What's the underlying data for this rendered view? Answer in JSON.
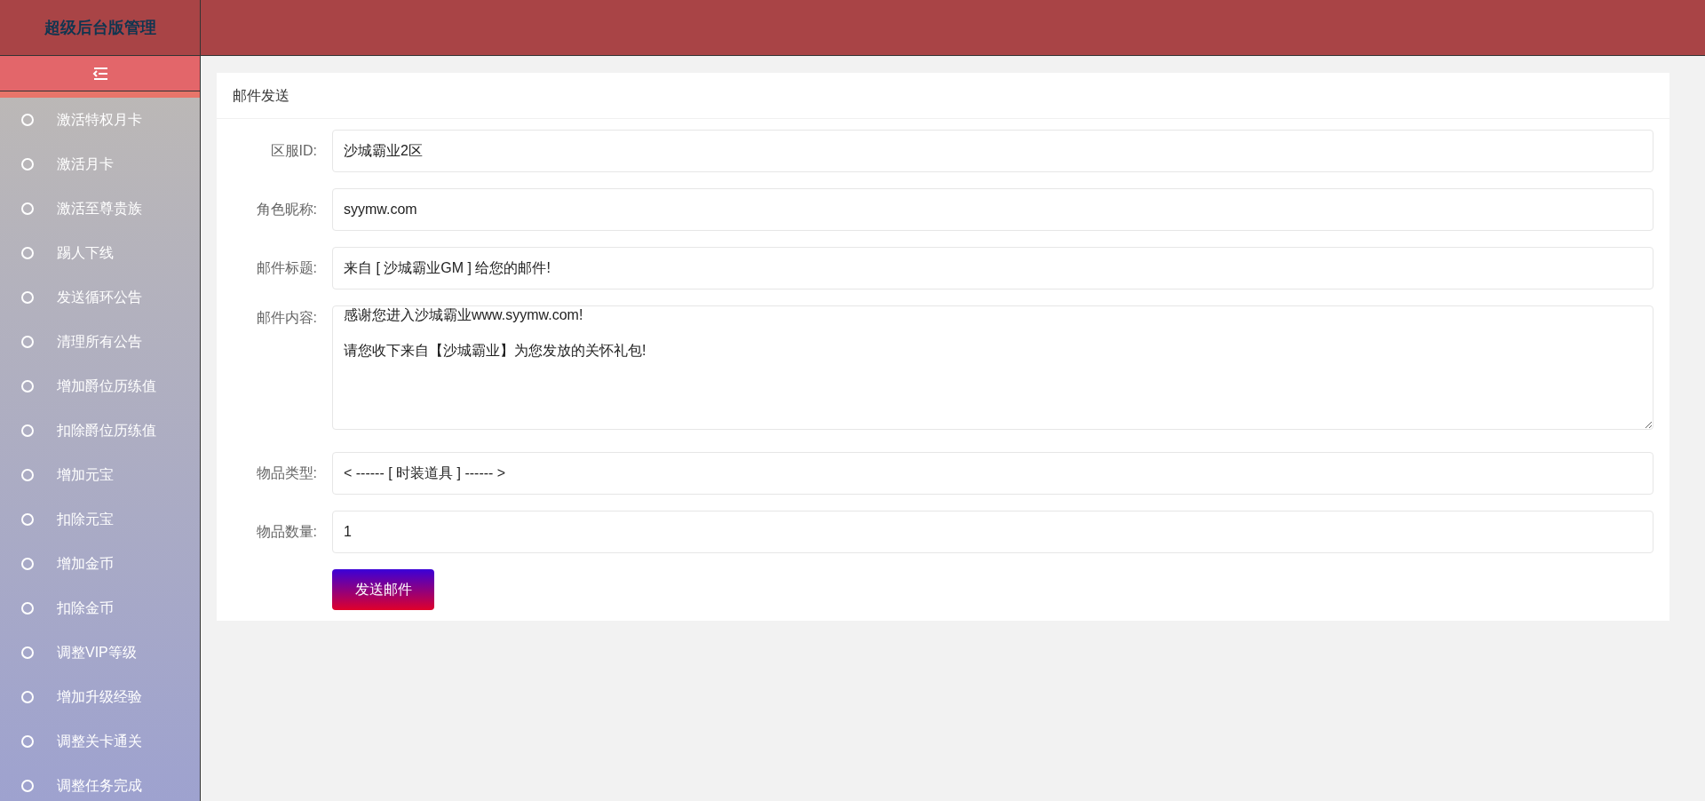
{
  "header": {
    "title": "超级后台版管理"
  },
  "sidebar": {
    "items": [
      {
        "label": "激活特权月卡",
        "selected": false
      },
      {
        "label": "激活月卡",
        "selected": false
      },
      {
        "label": "激活至尊贵族",
        "selected": false
      },
      {
        "label": "踢人下线",
        "selected": false
      },
      {
        "label": "发送循环公告",
        "selected": false
      },
      {
        "label": "清理所有公告",
        "selected": false
      },
      {
        "label": "增加爵位历练值",
        "selected": false
      },
      {
        "label": "扣除爵位历练值",
        "selected": false
      },
      {
        "label": "增加元宝",
        "selected": false
      },
      {
        "label": "扣除元宝",
        "selected": false
      },
      {
        "label": "增加金币",
        "selected": false
      },
      {
        "label": "扣除金币",
        "selected": false
      },
      {
        "label": "调整VIP等级",
        "selected": false
      },
      {
        "label": "增加升级经验",
        "selected": false
      },
      {
        "label": "调整关卡通关",
        "selected": false
      },
      {
        "label": "调整任务完成",
        "selected": false
      }
    ]
  },
  "card": {
    "title": "邮件发送",
    "fields": [
      {
        "kind": "input",
        "label": "区服ID:",
        "value": "沙城霸业2区"
      },
      {
        "kind": "input",
        "label": "角色昵称:",
        "value": "syymw.com"
      },
      {
        "kind": "input",
        "label": "邮件标题:",
        "value": "来自 [ 沙城霸业GM ] 给您的邮件!"
      },
      {
        "kind": "textarea",
        "label": "邮件内容:",
        "value": "感谢您进入沙城霸业www.syymw.com!\n\n请您收下来自【沙城霸业】为您发放的关怀礼包!"
      },
      {
        "kind": "select",
        "label": "物品类型:",
        "value": "< ------ [ 时装道具 ] ------ >"
      },
      {
        "kind": "input",
        "label": "物品数量:",
        "value": "1"
      }
    ],
    "submit": "发送邮件"
  }
}
